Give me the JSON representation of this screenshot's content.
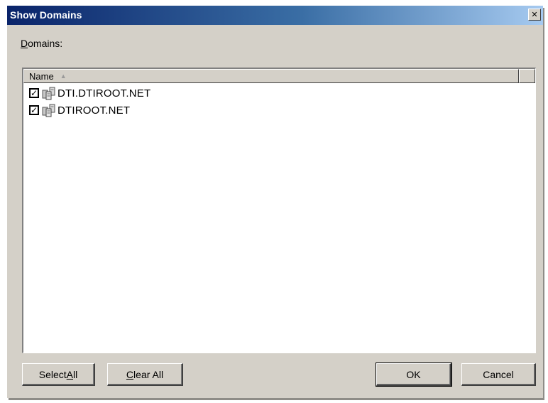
{
  "dialog": {
    "title": "Show Domains",
    "close_symbol": "✕"
  },
  "domains_label": {
    "accel": "D",
    "rest": "omains:"
  },
  "list": {
    "column_header": "Name",
    "sort_indicator": "▲",
    "items": [
      {
        "label": "DTI.DTIROOT.NET",
        "checked": true,
        "icon": "domain-icon"
      },
      {
        "label": "DTIROOT.NET",
        "checked": true,
        "icon": "domain-icon"
      }
    ]
  },
  "buttons": {
    "select_all": {
      "pre": "Select ",
      "accel": "A",
      "post": "ll"
    },
    "clear_all": {
      "pre": "",
      "accel": "C",
      "post": "lear All"
    },
    "ok": "OK",
    "cancel": "Cancel"
  },
  "colors": {
    "title_gradient_start": "#0a246a",
    "title_gradient_end": "#a6caf0",
    "face": "#d4d0c8"
  }
}
